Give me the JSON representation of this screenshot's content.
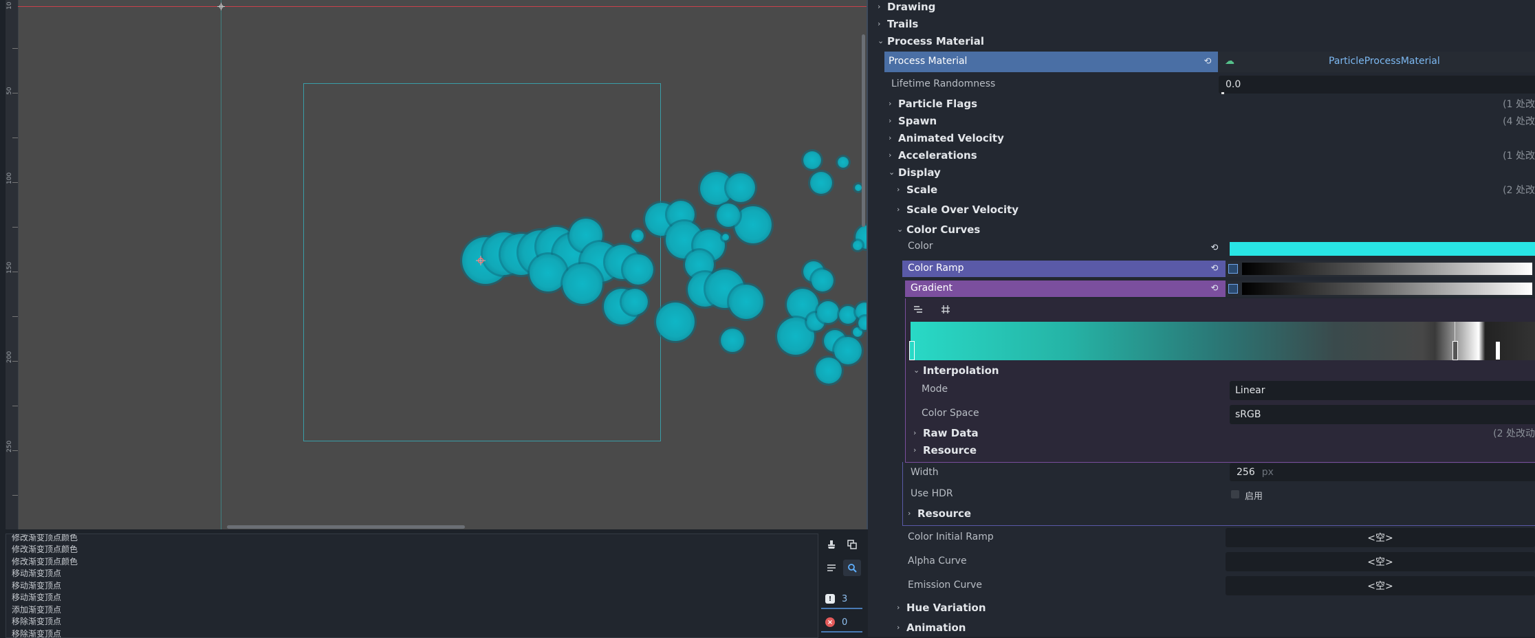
{
  "viewport": {
    "ruler_labels": [
      "10",
      "50",
      "100",
      "150",
      "200",
      "250"
    ]
  },
  "history": {
    "items": [
      "修改渐变顶点颜色",
      "修改渐变顶点颜色",
      "修改渐变顶点颜色",
      "移动渐变顶点",
      "移动渐变顶点",
      "移动渐变顶点",
      "添加渐变顶点",
      "移除渐变顶点",
      "移除渐变顶点"
    ],
    "warnings_count": "3",
    "errors_count": "0"
  },
  "inspector": {
    "drawing": "Drawing",
    "trails": "Trails",
    "process_material_section": "Process Material",
    "process_material_label": "Process Material",
    "process_material_value": "ParticleProcessMaterial",
    "lifetime_randomness_label": "Lifetime Randomness",
    "lifetime_randomness_value": "0.0",
    "particle_flags": "Particle Flags",
    "particle_flags_count": "(1 处改",
    "spawn": "Spawn",
    "spawn_count": "(4 处改",
    "animated_velocity": "Animated Velocity",
    "accelerations": "Accelerations",
    "accelerations_count": "(1 处改",
    "display": "Display",
    "scale": "Scale",
    "scale_count": "(2 处改",
    "scale_over_velocity": "Scale Over Velocity",
    "color_curves": "Color Curves",
    "color_label": "Color",
    "color_value": "#29e5e5",
    "color_ramp_label": "Color Ramp",
    "gradient_label": "Gradient",
    "interpolation": "Interpolation",
    "mode_label": "Mode",
    "mode_value": "Linear",
    "color_space_label": "Color Space",
    "color_space_value": "sRGB",
    "raw_data": "Raw Data",
    "raw_data_count": "(2 处改动",
    "resource_inner": "Resource",
    "width_label": "Width",
    "width_value": "256",
    "width_unit": "px",
    "use_hdr_label": "Use HDR",
    "use_hdr_value": "启用",
    "resource_outer": "Resource",
    "color_initial_ramp_label": "Color Initial Ramp",
    "empty_value": "<空>",
    "alpha_curve_label": "Alpha Curve",
    "emission_curve_label": "Emission Curve",
    "hue_variation": "Hue Variation",
    "animation": "Animation"
  },
  "colors": {
    "accent_blue": "#4a6fa5",
    "color_ramp_header": "#5a5aa8",
    "gradient_header": "#7b4f9e",
    "particle": "#11a9b8"
  }
}
